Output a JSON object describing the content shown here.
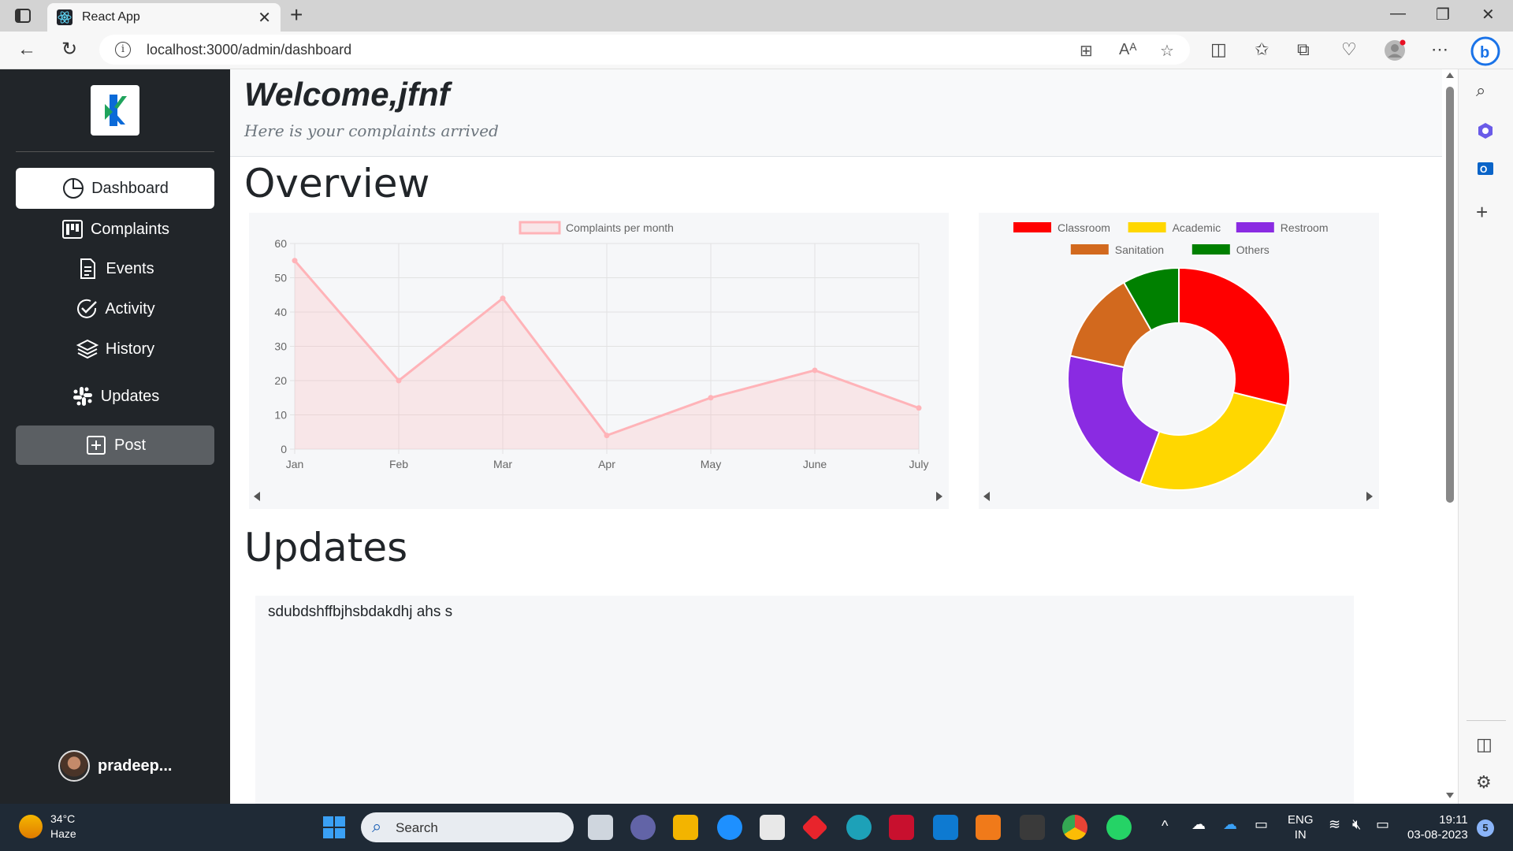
{
  "browser": {
    "tab_title": "React App",
    "url": "localhost:3000/admin/dashboard"
  },
  "sidebar": {
    "items": [
      {
        "label": "Dashboard",
        "icon": "pie-icon",
        "active": true
      },
      {
        "label": "Complaints",
        "icon": "kanban-icon"
      },
      {
        "label": "Events",
        "icon": "document-icon"
      },
      {
        "label": "Activity",
        "icon": "check-circle-icon"
      },
      {
        "label": "History",
        "icon": "layers-icon"
      },
      {
        "label": "Updates",
        "icon": "slack-icon"
      },
      {
        "label": "Post",
        "icon": "plus-square-icon"
      }
    ],
    "user_name": "pradeep..."
  },
  "main": {
    "welcome_title": "Welcome,jfnf",
    "welcome_subtitle": "Here is your complaints arrived",
    "overview_title": "Overview",
    "updates_title": "Updates",
    "update_text": "sdubdshffbjhsbdakdhj ahs s"
  },
  "chart_data": [
    {
      "type": "area",
      "categories": [
        "Jan",
        "Feb",
        "Mar",
        "Apr",
        "May",
        "June",
        "July"
      ],
      "series": [
        {
          "name": "Complaints per month",
          "values": [
            55,
            20,
            44,
            4,
            15,
            23,
            12
          ]
        }
      ],
      "ylim": [
        0,
        60
      ],
      "yticks": [
        0,
        10,
        20,
        30,
        40,
        50,
        60
      ],
      "grid": true,
      "legend": "top",
      "color": "#ffb3b8"
    },
    {
      "type": "pie",
      "labels": [
        "Classroom",
        "Academic",
        "Restroom",
        "Sanitation",
        "Others"
      ],
      "values": [
        28,
        26,
        22,
        13,
        8
      ],
      "colors": [
        "#ff0000",
        "#ffd700",
        "#8a2be2",
        "#d2691e",
        "#008000"
      ],
      "donut": true,
      "legend": "top"
    }
  ],
  "taskbar": {
    "temperature": "34°C",
    "weather": "Haze",
    "search_label": "Search",
    "lang_1": "ENG",
    "lang_2": "IN",
    "time": "19:11",
    "date": "03-08-2023",
    "notifications": "5"
  }
}
